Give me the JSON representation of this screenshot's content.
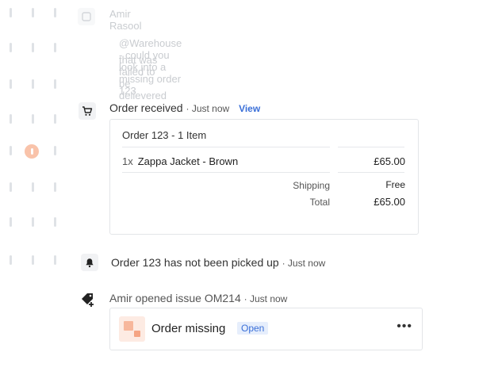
{
  "faded_comment": {
    "author_line": "Amir Rasool",
    "text_line1": "@Warehouse - could you look into a missing order 123",
    "text_line2": "that was failed to be delievered"
  },
  "events": {
    "order_received": {
      "title": "Order received",
      "meta": "· Just now",
      "link_label": "View",
      "icon": "cart-icon"
    },
    "not_picked_up": {
      "title": "Order 123 has not been picked up",
      "meta": "· Just now",
      "icon": "bell-icon"
    },
    "issue_opened": {
      "title": "Amir opened issue OM214",
      "meta": "· Just now",
      "icon": "tag-add-icon"
    }
  },
  "order_card": {
    "title": "Order 123 - 1 Item",
    "line_item": {
      "qty": "1x",
      "name": "Zappa Jacket - Brown",
      "price": "£65.00"
    },
    "shipping_label": "Shipping",
    "shipping_value": "Free",
    "total_label": "Total",
    "total_value": "£65.00"
  },
  "issue_card": {
    "title": "Order missing",
    "status": "Open",
    "more_label": "•••"
  },
  "colors": {
    "accent_link": "#3a6fd8",
    "status_pill_bg": "#e6eefc",
    "avatar": "#f9c3aa"
  }
}
